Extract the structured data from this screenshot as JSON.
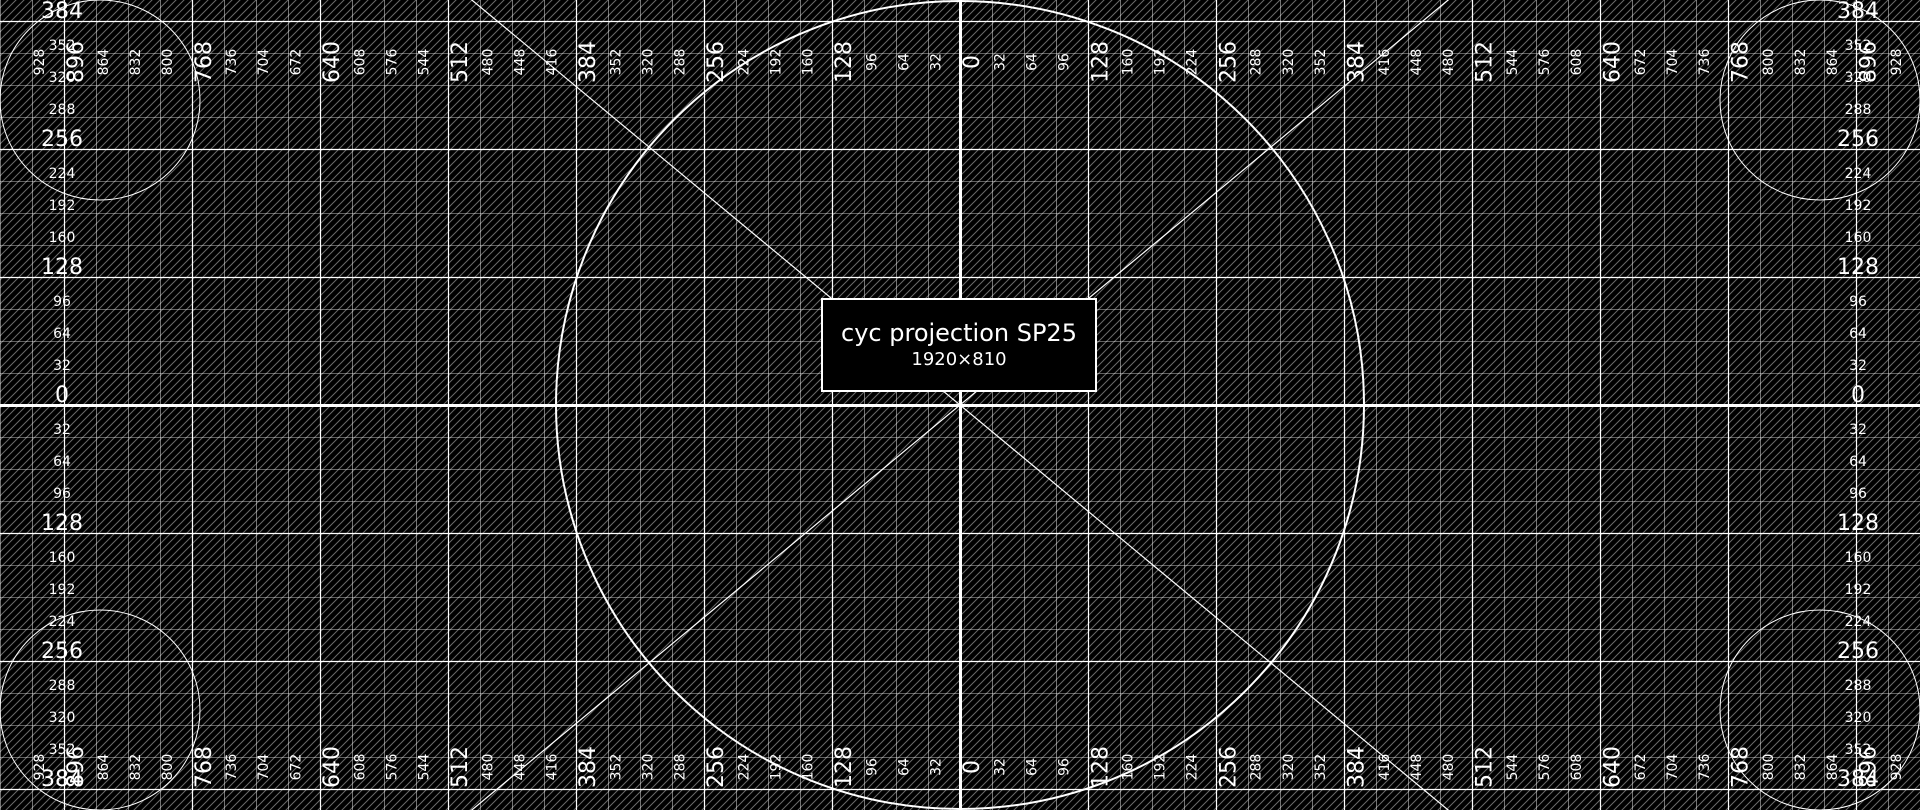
{
  "title": "cyc projection SP25",
  "resolution": "1920×810",
  "colors": {
    "background": "#000000",
    "lines": "#ffffff"
  },
  "pattern": {
    "type": "test-pattern-grid",
    "hatching": "diagonal",
    "circles": "center-and-corners"
  },
  "axis_marks": {
    "horizontal": [
      "928",
      "896",
      "864",
      "832",
      "800",
      "768",
      "736",
      "704",
      "672",
      "640",
      "608",
      "576",
      "544",
      "512",
      "480",
      "448",
      "416",
      "384",
      "352",
      "320",
      "288",
      "256",
      "224",
      "192",
      "160",
      "128",
      "96",
      "64",
      "32",
      "0",
      "32",
      "64",
      "96",
      "128",
      "160",
      "192",
      "224",
      "256",
      "288",
      "320",
      "352",
      "384",
      "416",
      "448",
      "480",
      "512",
      "544",
      "576",
      "608",
      "640",
      "672",
      "704",
      "736",
      "768",
      "800",
      "832",
      "864",
      "896",
      "928"
    ],
    "vertical": [
      "384",
      "352",
      "320",
      "288",
      "256",
      "224",
      "192",
      "160",
      "128",
      "96",
      "64",
      "32",
      "0",
      "32",
      "64",
      "96",
      "128",
      "160",
      "192",
      "224",
      "256",
      "288",
      "320",
      "352",
      "384"
    ]
  }
}
